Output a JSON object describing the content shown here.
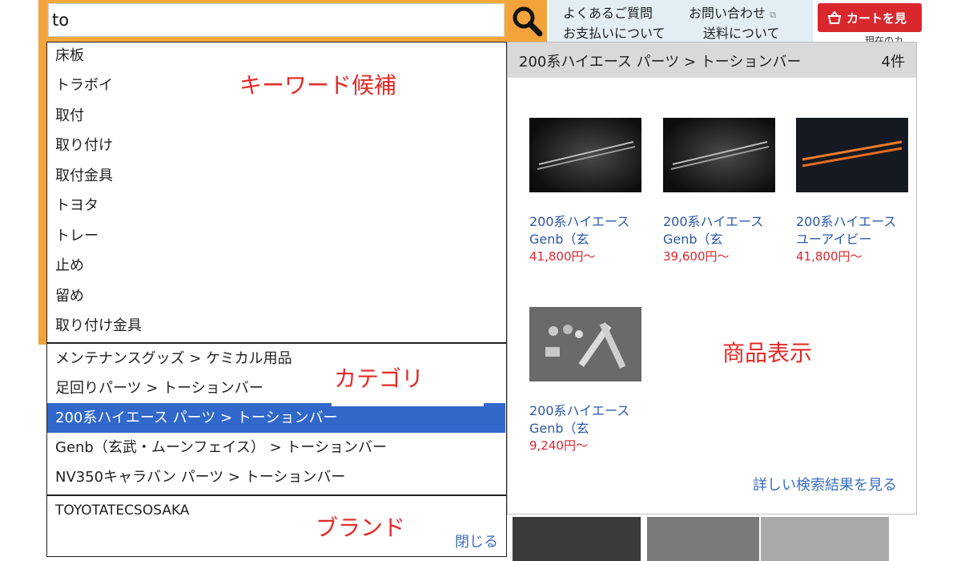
{
  "search": {
    "value": "to",
    "button_icon": "magnifier-icon"
  },
  "header": {
    "links": [
      "よくあるご質問",
      "お問い合わせ",
      "お支払いについて",
      "送料について"
    ],
    "cart_label": "カートを見",
    "cart_icon": "basket-icon",
    "under_cart": "現在のカ"
  },
  "keywords": {
    "annotation": "キーワード候補",
    "items": [
      "床板",
      "トラボイ",
      "取付",
      "取り付け",
      "取付金具",
      "トヨタ",
      "トレー",
      "止め",
      "留め",
      "取り付け金具"
    ]
  },
  "categories": {
    "annotation": "カテゴリ",
    "items": [
      "メンテナンスグッズ > ケミカル用品",
      "足回りパーツ > トーションバー",
      "200系ハイエース パーツ > トーションバー",
      "Genb（玄武・ムーンフェイス） > トーションバー",
      "NV350キャラバン パーツ > トーションバー"
    ],
    "selected_index": 2
  },
  "brands": {
    "annotation": "ブランド",
    "items": [
      "TOYOTATECSOSAKA"
    ],
    "close_label": "閉じる"
  },
  "products": {
    "header_title": "200系ハイエース パーツ > トーションバー",
    "count": "4件",
    "annotation": "商品表示",
    "items": [
      {
        "name": "200系ハイエース Genb（玄",
        "price": "41,800円～"
      },
      {
        "name": "200系ハイエース Genb（玄",
        "price": "39,600円～"
      },
      {
        "name": "200系ハイエース ユーアイビー",
        "price": "41,800円～"
      },
      {
        "name": "200系ハイエース Genb（玄",
        "price": "9,240円～"
      }
    ],
    "more_label": "詳しい検索結果を見る"
  },
  "colors": {
    "accent": "#f3a33b",
    "selected": "#3168c9",
    "annotation": "#e32a26",
    "link": "#3a6ec0",
    "price": "#d9272e"
  }
}
